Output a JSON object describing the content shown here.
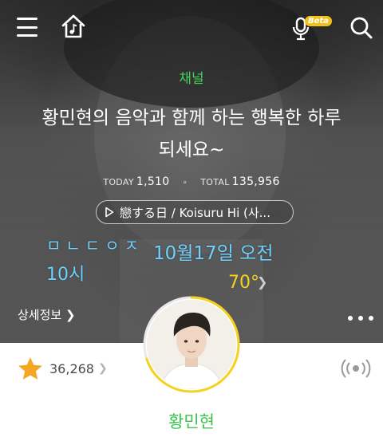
{
  "header": {
    "menu_icon": "hamburger-menu-icon",
    "home_icon": "music-home-icon",
    "mic_icon": "microphone-icon",
    "beta_label": "Beta",
    "search_icon": "search-icon"
  },
  "channel": {
    "label": "채널",
    "title_line1": "황민현의 음악과 함께 하는 행복한 하루",
    "title_line2": "되세요~",
    "today_label": "TODAY",
    "today_count": "1,510",
    "total_label": "TOTAL",
    "total_count": "135,956",
    "now_playing": "戀する日 / Koisuru Hi (사..."
  },
  "handwritten": {
    "initials": "ㅁㄴㄷㅇㅈ",
    "date": "10월17일 오전",
    "time": "10시"
  },
  "progress": {
    "percent": 70,
    "text": "70°",
    "ring_color": "#f5d21c"
  },
  "detail": {
    "label": "상세정보 ❯"
  },
  "profile": {
    "star_count": "36,268",
    "star_color": "#f5a623",
    "name": "황민현",
    "accent_color": "#3cc44c"
  }
}
